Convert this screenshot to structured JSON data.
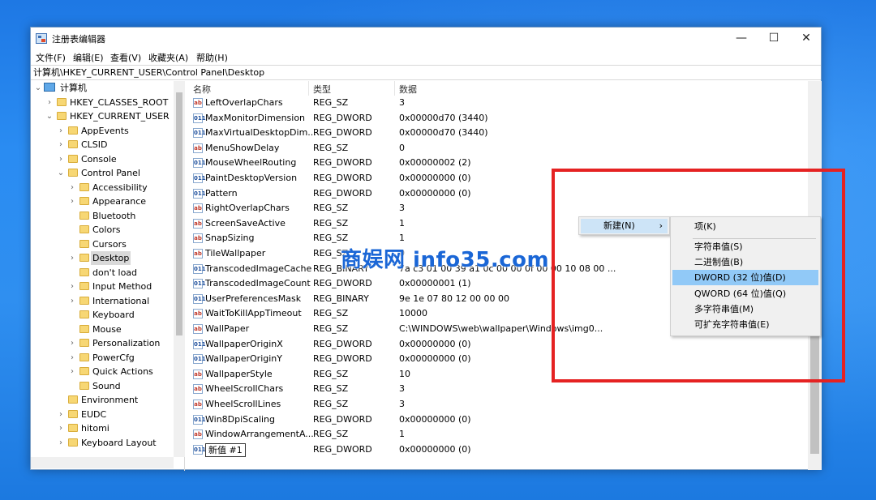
{
  "window": {
    "title": "注册表编辑器",
    "minimize": "—",
    "maximize": "☐",
    "close": "✕"
  },
  "menu": [
    "文件(F)",
    "编辑(E)",
    "查看(V)",
    "收藏夹(A)",
    "帮助(H)"
  ],
  "address": "计算机\\HKEY_CURRENT_USER\\Control Panel\\Desktop",
  "tree": {
    "root": "计算机",
    "items": [
      {
        "label": "HKEY_CLASSES_ROOT",
        "chev": "›"
      },
      {
        "label": "HKEY_CURRENT_USER",
        "chev": "⌄"
      },
      {
        "label": "AppEvents",
        "chev": "›"
      },
      {
        "label": "CLSID",
        "chev": "›"
      },
      {
        "label": "Console",
        "chev": "›"
      },
      {
        "label": "Control Panel",
        "chev": "⌄"
      },
      {
        "label": "Accessibility",
        "chev": "›"
      },
      {
        "label": "Appearance",
        "chev": "›"
      },
      {
        "label": "Bluetooth",
        "chev": ""
      },
      {
        "label": "Colors",
        "chev": ""
      },
      {
        "label": "Cursors",
        "chev": ""
      },
      {
        "label": "Desktop",
        "chev": "›"
      },
      {
        "label": "don't load",
        "chev": ""
      },
      {
        "label": "Input Method",
        "chev": "›"
      },
      {
        "label": "International",
        "chev": "›"
      },
      {
        "label": "Keyboard",
        "chev": ""
      },
      {
        "label": "Mouse",
        "chev": ""
      },
      {
        "label": "Personalization",
        "chev": "›"
      },
      {
        "label": "PowerCfg",
        "chev": "›"
      },
      {
        "label": "Quick Actions",
        "chev": "›"
      },
      {
        "label": "Sound",
        "chev": ""
      },
      {
        "label": "Environment",
        "chev": ""
      },
      {
        "label": "EUDC",
        "chev": "›"
      },
      {
        "label": "hitomi",
        "chev": "›"
      },
      {
        "label": "Keyboard Layout",
        "chev": "›"
      }
    ]
  },
  "columns": {
    "name": "名称",
    "type": "类型",
    "data": "数据"
  },
  "rows": [
    {
      "icon": "ab",
      "name": "LeftOverlapChars",
      "type": "REG_SZ",
      "data": "3"
    },
    {
      "icon": "bin",
      "name": "MaxMonitorDimension",
      "type": "REG_DWORD",
      "data": "0x00000d70 (3440)"
    },
    {
      "icon": "bin",
      "name": "MaxVirtualDesktopDim...",
      "type": "REG_DWORD",
      "data": "0x00000d70 (3440)"
    },
    {
      "icon": "ab",
      "name": "MenuShowDelay",
      "type": "REG_SZ",
      "data": "0"
    },
    {
      "icon": "bin",
      "name": "MouseWheelRouting",
      "type": "REG_DWORD",
      "data": "0x00000002 (2)"
    },
    {
      "icon": "bin",
      "name": "PaintDesktopVersion",
      "type": "REG_DWORD",
      "data": "0x00000000 (0)"
    },
    {
      "icon": "bin",
      "name": "Pattern",
      "type": "REG_DWORD",
      "data": "0x00000000 (0)"
    },
    {
      "icon": "ab",
      "name": "RightOverlapChars",
      "type": "REG_SZ",
      "data": "3"
    },
    {
      "icon": "ab",
      "name": "ScreenSaveActive",
      "type": "REG_SZ",
      "data": "1"
    },
    {
      "icon": "ab",
      "name": "SnapSizing",
      "type": "REG_SZ",
      "data": "1"
    },
    {
      "icon": "ab",
      "name": "TileWallpaper",
      "type": "REG_SZ",
      "data": "0"
    },
    {
      "icon": "bin",
      "name": "TranscodedImageCache",
      "type": "REG_BINARY",
      "data": "7a c3 01 00 39 a1 0c 00 00 0f 00 00 10 08 00 ..."
    },
    {
      "icon": "bin",
      "name": "TranscodedImageCount",
      "type": "REG_DWORD",
      "data": "0x00000001 (1)"
    },
    {
      "icon": "bin",
      "name": "UserPreferencesMask",
      "type": "REG_BINARY",
      "data": "9e 1e 07 80 12 00 00 00"
    },
    {
      "icon": "ab",
      "name": "WaitToKillAppTimeout",
      "type": "REG_SZ",
      "data": "10000"
    },
    {
      "icon": "ab",
      "name": "WallPaper",
      "type": "REG_SZ",
      "data": "C:\\WINDOWS\\web\\wallpaper\\Windows\\img0..."
    },
    {
      "icon": "bin",
      "name": "WallpaperOriginX",
      "type": "REG_DWORD",
      "data": "0x00000000 (0)"
    },
    {
      "icon": "bin",
      "name": "WallpaperOriginY",
      "type": "REG_DWORD",
      "data": "0x00000000 (0)"
    },
    {
      "icon": "ab",
      "name": "WallpaperStyle",
      "type": "REG_SZ",
      "data": "10"
    },
    {
      "icon": "ab",
      "name": "WheelScrollChars",
      "type": "REG_SZ",
      "data": "3"
    },
    {
      "icon": "ab",
      "name": "WheelScrollLines",
      "type": "REG_SZ",
      "data": "3"
    },
    {
      "icon": "bin",
      "name": "Win8DpiScaling",
      "type": "REG_DWORD",
      "data": "0x00000000 (0)"
    },
    {
      "icon": "ab",
      "name": "WindowArrangementA...",
      "type": "REG_SZ",
      "data": "1"
    },
    {
      "icon": "bin",
      "name": "新值 #1",
      "type": "REG_DWORD",
      "data": "0x00000000 (0)"
    }
  ],
  "context_menu": {
    "new_label": "新建(N)",
    "arrow": "›",
    "submenu": [
      "项(K)",
      "字符串值(S)",
      "二进制值(B)",
      "DWORD (32 位)值(D)",
      "QWORD (64 位)值(Q)",
      "多字符串值(M)",
      "可扩充字符串值(E)"
    ],
    "highlighted_index": 3
  },
  "overlay_watermark": "商娱网 info35.com",
  "colors": {
    "highlight": "#91c9f7",
    "annotation": "#e52222"
  }
}
